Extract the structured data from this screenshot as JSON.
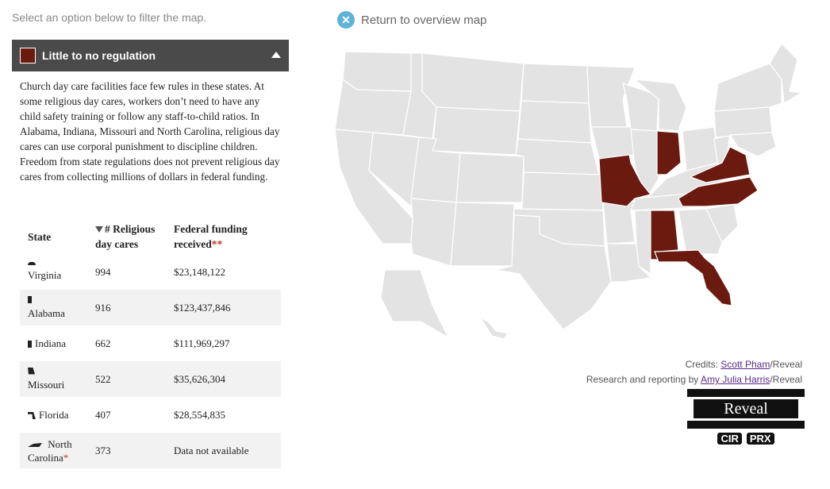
{
  "instruction": "Select an option below to filter the map.",
  "filter": {
    "label": "Little to no regulation",
    "swatch_color": "#6b1a10",
    "expanded": true,
    "toggle_icon": "caret-up-icon"
  },
  "description": "Church day care facilities face few rules in these states. At some religious day cares, workers don’t need to have any child safety training or follow any staff-to-child ratios. In Alabama, Indiana, Missouri and North Carolina, religious day cares can use corporal punishment to discipline children. Freedom from state regulations does not prevent religious day cares from collecting millions of dollars in federal funding.",
  "table": {
    "headers": {
      "state": "State",
      "count": "# Religious day cares",
      "funding": "Federal funding received",
      "funding_mark": "**"
    },
    "rows": [
      {
        "state": "Virginia",
        "count": "994",
        "funding": "$23,148,122",
        "mark": ""
      },
      {
        "state": "Alabama",
        "count": "916",
        "funding": "$123,437,846",
        "mark": ""
      },
      {
        "state": "Indiana",
        "count": "662",
        "funding": "$111,969,297",
        "mark": ""
      },
      {
        "state": "Missouri",
        "count": "522",
        "funding": "$35,626,304",
        "mark": ""
      },
      {
        "state": "Florida",
        "count": "407",
        "funding": "$28,554,835",
        "mark": ""
      },
      {
        "state": "North Carolina",
        "count": "373",
        "funding": "Data not available",
        "mark": "*"
      }
    ]
  },
  "return_link": {
    "label": "Return to overview map",
    "icon": "close-icon"
  },
  "map": {
    "highlight_color": "#6b1a10",
    "base_color": "#e3e3e3",
    "highlighted_states": [
      "Virginia",
      "Alabama",
      "Indiana",
      "Missouri",
      "Florida",
      "North Carolina"
    ]
  },
  "credits": {
    "line1_prefix": "Credits: ",
    "line1_name": "Scott Pham",
    "line1_suffix": "/Reveal",
    "line2_prefix": "Research and reporting by ",
    "line2_name": "Amy Julia Harris",
    "line2_suffix": "/Reveal"
  },
  "logo": {
    "word": "Reveal",
    "sub1": "CIR",
    "sub2": "PRX"
  }
}
